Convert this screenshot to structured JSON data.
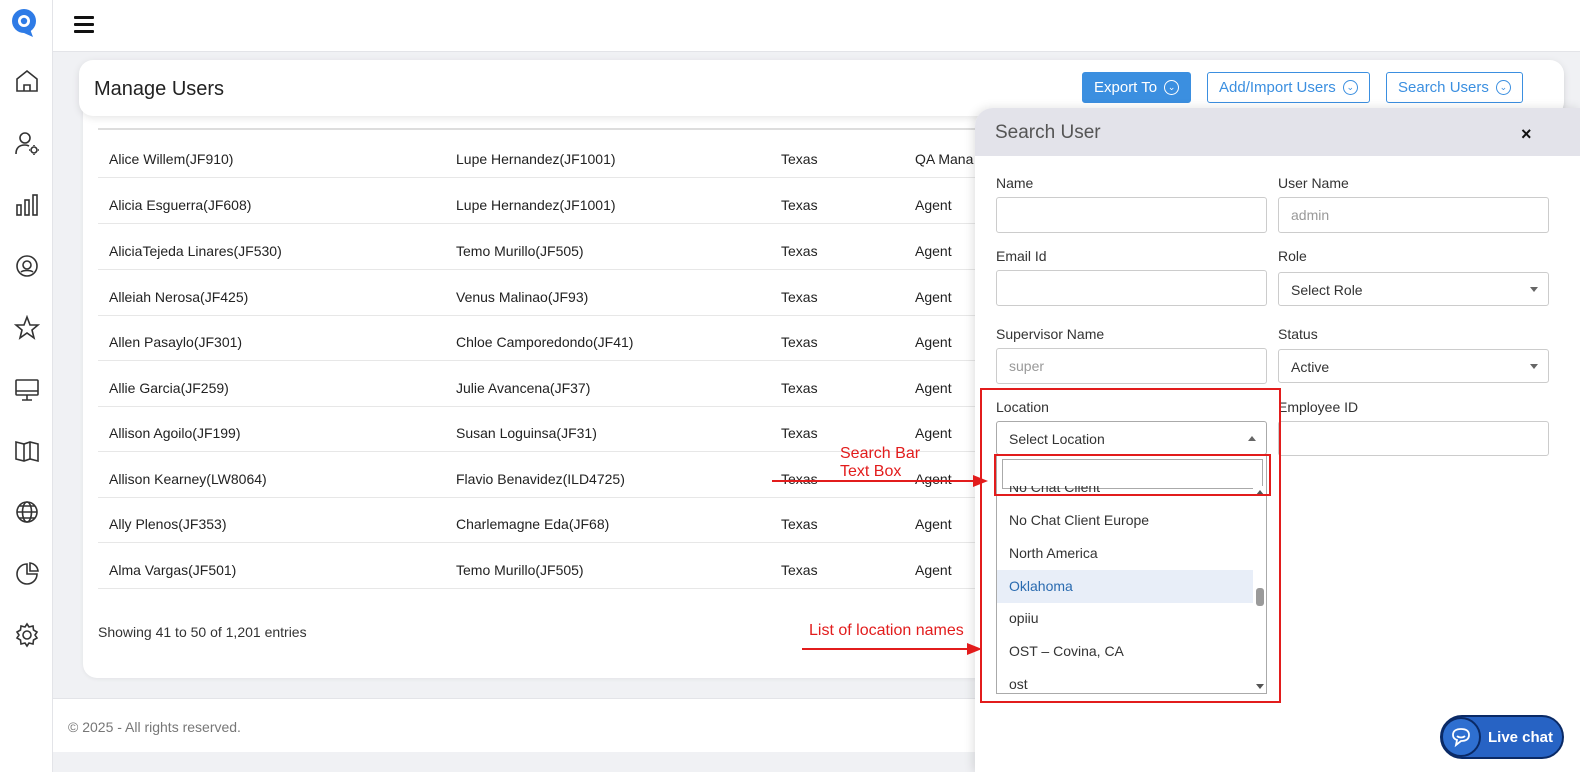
{
  "header": {
    "page_title": "Manage Users",
    "buttons": {
      "export": "Export To",
      "add_import": "Add/Import Users",
      "search": "Search Users"
    }
  },
  "sidebar": {
    "items": [
      "home-icon",
      "user-settings-icon",
      "bar-chart-icon",
      "headset-icon",
      "star-icon",
      "monitor-icon",
      "book-icon",
      "globe-icon",
      "pie-chart-icon",
      "gear-icon"
    ]
  },
  "table": {
    "rows": [
      [
        "Alice Willem(JF910)",
        "Lupe Hernandez(JF1001)",
        "Texas",
        "QA Mana"
      ],
      [
        "Alicia Esguerra(JF608)",
        "Lupe Hernandez(JF1001)",
        "Texas",
        "Agent"
      ],
      [
        "AliciaTejeda Linares(JF530)",
        "Temo Murillo(JF505)",
        "Texas",
        "Agent"
      ],
      [
        "Alleiah Nerosa(JF425)",
        "Venus Malinao(JF93)",
        "Texas",
        "Agent"
      ],
      [
        "Allen Pasaylo(JF301)",
        "Chloe Camporedondo(JF41)",
        "Texas",
        "Agent"
      ],
      [
        "Allie Garcia(JF259)",
        "Julie Avancena(JF37)",
        "Texas",
        "Agent"
      ],
      [
        "Allison Agoilo(JF199)",
        "Susan Loguinsa(JF31)",
        "Texas",
        "Agent"
      ],
      [
        "Allison Kearney(LW8064)",
        "Flavio Benavidez(ILD4725)",
        "Texas",
        "Agent"
      ],
      [
        "Ally Plenos(JF353)",
        "Charlemagne Eda(JF68)",
        "Texas",
        "Agent"
      ],
      [
        "Alma Vargas(JF501)",
        "Temo Murillo(JF505)",
        "Texas",
        "Agent"
      ]
    ],
    "showing": "Showing 41 to 50 of 1,201 entries"
  },
  "footer": {
    "text": "© 2025 - All rights reserved."
  },
  "search_panel": {
    "title": "Search User",
    "close": "×",
    "name_label": "Name",
    "name_value": "",
    "username_label": "User Name",
    "username_placeholder": "admin",
    "email_label": "Email Id",
    "email_value": "",
    "role_label": "Role",
    "role_value": "Select Role",
    "supervisor_label": "Supervisor Name",
    "supervisor_placeholder": "super",
    "status_label": "Status",
    "status_value": "Active",
    "location_label": "Location",
    "location_value": "Select Location",
    "employee_id_label": "Employee ID",
    "employee_id_value": "",
    "location_options": [
      "No Chat Client",
      "No Chat Client Europe",
      "North America",
      "Oklahoma",
      "opiiu",
      "OST – Covina, CA",
      "ost"
    ],
    "highlighted_option": "Oklahoma"
  },
  "annotations": {
    "search_bar": "Search Bar\nText Box",
    "list": "List of location names"
  },
  "live_chat": {
    "label": "Live chat"
  },
  "colors": {
    "accent": "#3b8fe0",
    "annotation": "#e21c1c",
    "live_chat": "#2763c4"
  }
}
